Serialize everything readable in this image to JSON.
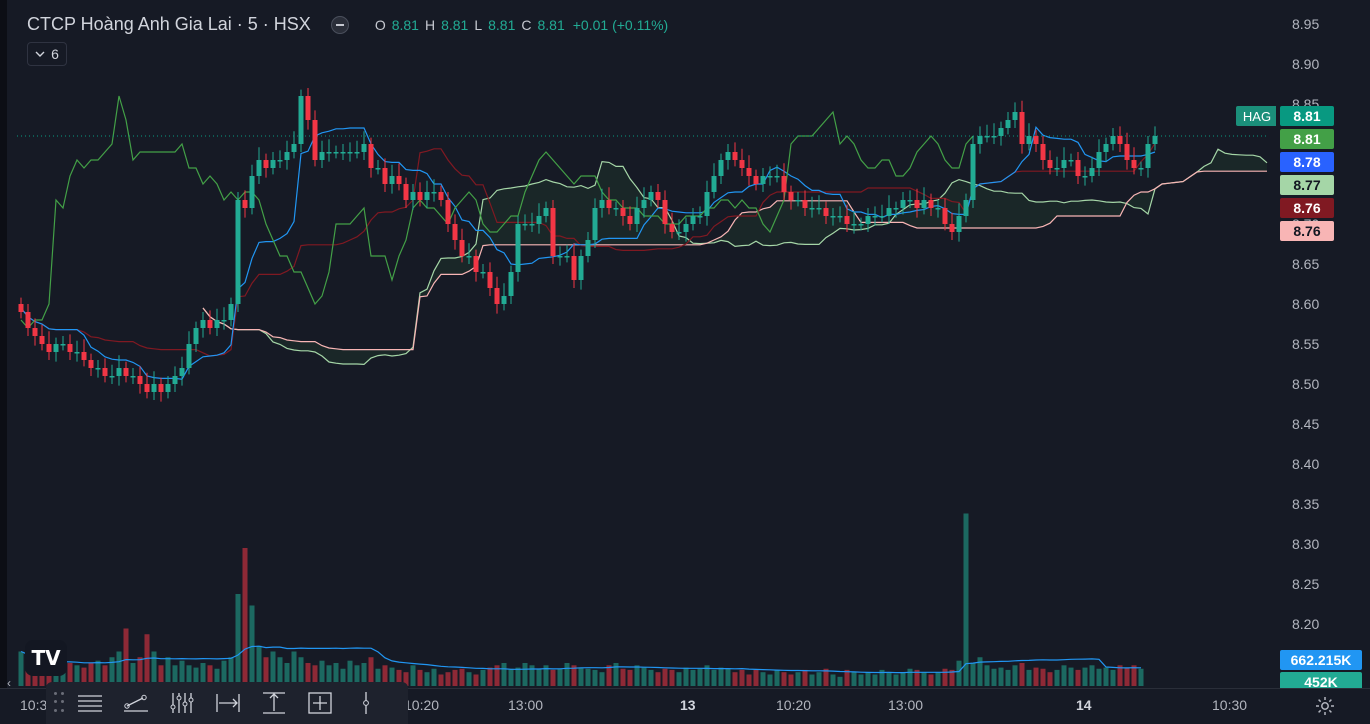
{
  "header": {
    "title": "CTCP Hoàng Anh Gia Lai · 5 · HSX",
    "ohlc": [
      {
        "k": "O",
        "v": "8.81"
      },
      {
        "k": "H",
        "v": "8.81"
      },
      {
        "k": "L",
        "v": "8.81"
      },
      {
        "k": "C",
        "v": "8.81"
      }
    ],
    "change": "+0.01 (+0.11%)",
    "indicator_count": "6"
  },
  "price_scale": {
    "ticks": [
      "8.95",
      "8.90",
      "8.85",
      "8.80",
      "8.75",
      "8.70",
      "8.65",
      "8.60",
      "8.55",
      "8.50",
      "8.45",
      "8.40",
      "8.35",
      "8.30",
      "8.25",
      "8.20"
    ],
    "symbol_tag": "HAG",
    "labels": [
      {
        "text": "8.81",
        "bg": "#089981",
        "fg": "#ffffff"
      },
      {
        "text": "8.81",
        "bg": "#43a047",
        "fg": "#ffffff"
      },
      {
        "text": "8.78",
        "bg": "#2962ff",
        "fg": "#ffffff"
      },
      {
        "text": "8.77",
        "bg": "#a5d6a7",
        "fg": "#131722"
      },
      {
        "text": "8.76",
        "bg": "#801922",
        "fg": "#ffffff"
      },
      {
        "text": "8.76",
        "bg": "#f8b5b5",
        "fg": "#131722"
      }
    ],
    "volume_labels": [
      {
        "text": "662.215K",
        "bg": "#2196f3"
      },
      {
        "text": "452K",
        "bg": "#22ab94"
      }
    ]
  },
  "time_axis": [
    {
      "text": "10:3",
      "bold": false
    },
    {
      "text": "10:20",
      "bold": false
    },
    {
      "text": "13:00",
      "bold": false
    },
    {
      "text": "13",
      "bold": true
    },
    {
      "text": "10:20",
      "bold": false
    },
    {
      "text": "13:00",
      "bold": false
    },
    {
      "text": "14",
      "bold": true
    },
    {
      "text": "10:30",
      "bold": false
    }
  ],
  "colors": {
    "up": "#22ab94",
    "down": "#f23645",
    "tenkan": "#2196f3",
    "kijun": "#801922",
    "lagging": "#43a047",
    "span_a": "#a5d6a7",
    "span_b": "#f8b5b5",
    "vol_ma": "#2196f3"
  },
  "toolbar": {
    "tools": [
      "horizontal-lines-icon",
      "trend-line-icon",
      "indicator-sliders-icon",
      "date-range-icon",
      "price-range-icon",
      "date-price-range-icon",
      "cursor-line-icon"
    ]
  },
  "chart_data": {
    "type": "candlestick",
    "symbol": "HAG",
    "interval": "5",
    "ylim": [
      8.15,
      8.98
    ],
    "price_ticks": [
      8.95,
      8.9,
      8.85,
      8.8,
      8.75,
      8.7,
      8.65,
      8.6,
      8.55,
      8.5,
      8.45,
      8.4,
      8.35,
      8.3,
      8.25,
      8.2
    ],
    "close": [
      8.59,
      8.57,
      8.56,
      8.55,
      8.54,
      8.55,
      8.55,
      8.54,
      8.54,
      8.53,
      8.52,
      8.52,
      8.51,
      8.51,
      8.52,
      8.51,
      8.51,
      8.5,
      8.49,
      8.5,
      8.49,
      8.5,
      8.51,
      8.52,
      8.55,
      8.57,
      8.58,
      8.57,
      8.58,
      8.58,
      8.6,
      8.73,
      8.72,
      8.76,
      8.78,
      8.77,
      8.78,
      8.78,
      8.79,
      8.8,
      8.86,
      8.83,
      8.78,
      8.79,
      8.79,
      8.79,
      8.79,
      8.79,
      8.79,
      8.8,
      8.77,
      8.77,
      8.75,
      8.76,
      8.75,
      8.73,
      8.74,
      8.73,
      8.74,
      8.74,
      8.73,
      8.7,
      8.68,
      8.66,
      8.66,
      8.64,
      8.64,
      8.62,
      8.6,
      8.61,
      8.64,
      8.7,
      8.7,
      8.7,
      8.71,
      8.72,
      8.66,
      8.66,
      8.66,
      8.63,
      8.66,
      8.68,
      8.72,
      8.73,
      8.72,
      8.72,
      8.71,
      8.7,
      8.72,
      8.73,
      8.74,
      8.73,
      8.7,
      8.69,
      8.69,
      8.7,
      8.71,
      8.71,
      8.74,
      8.76,
      8.78,
      8.79,
      8.78,
      8.77,
      8.76,
      8.75,
      8.76,
      8.76,
      8.76,
      8.74,
      8.73,
      8.73,
      8.72,
      8.72,
      8.72,
      8.71,
      8.71,
      8.71,
      8.7,
      8.7,
      8.7,
      8.71,
      8.71,
      8.71,
      8.72,
      8.72,
      8.73,
      8.73,
      8.72,
      8.73,
      8.72,
      8.72,
      8.7,
      8.69,
      8.71,
      8.73,
      8.8,
      8.81,
      8.81,
      8.81,
      8.82,
      8.83,
      8.84,
      8.8,
      8.81,
      8.8,
      8.78,
      8.77,
      8.77,
      8.78,
      8.78,
      8.76,
      8.76,
      8.77,
      8.79,
      8.8,
      8.81,
      8.8,
      8.78,
      8.77,
      8.77,
      8.8,
      8.81
    ],
    "volume": [
      30,
      25,
      20,
      18,
      22,
      18,
      15,
      20,
      18,
      16,
      20,
      22,
      18,
      25,
      30,
      50,
      20,
      25,
      45,
      30,
      18,
      25,
      18,
      22,
      18,
      16,
      20,
      18,
      15,
      22,
      25,
      80,
      120,
      70,
      35,
      25,
      30,
      25,
      20,
      30,
      25,
      20,
      18,
      22,
      18,
      20,
      15,
      22,
      18,
      20,
      25,
      15,
      18,
      16,
      14,
      12,
      18,
      14,
      12,
      15,
      10,
      12,
      14,
      15,
      12,
      10,
      14,
      16,
      18,
      20,
      15,
      16,
      20,
      18,
      15,
      18,
      14,
      15,
      20,
      18,
      16,
      15,
      14,
      12,
      18,
      20,
      15,
      14,
      18,
      16,
      14,
      12,
      15,
      14,
      12,
      16,
      14,
      15,
      18,
      14,
      16,
      15,
      12,
      14,
      10,
      14,
      12,
      10,
      14,
      12,
      10,
      12,
      14,
      10,
      12,
      15,
      10,
      8,
      14,
      12,
      10,
      12,
      10,
      14,
      12,
      10,
      12,
      15,
      14,
      12,
      10,
      12,
      15,
      14,
      22,
      150,
      20,
      25,
      18,
      15,
      16,
      14,
      18,
      20,
      14,
      16,
      15,
      12,
      14,
      18,
      16,
      14,
      16,
      18,
      15,
      16,
      14,
      18,
      16,
      18,
      15
    ],
    "volume_ma_last": "662.215K",
    "last_volume": "452K"
  }
}
